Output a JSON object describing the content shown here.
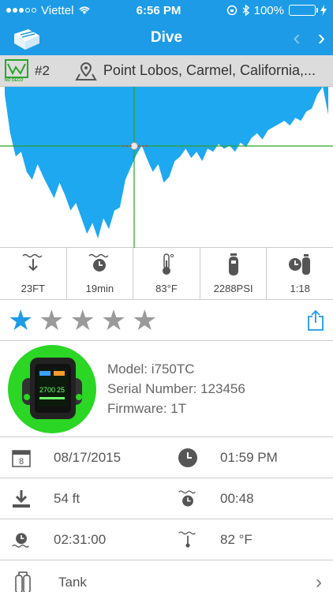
{
  "status": {
    "carrier": "Viettel",
    "time": "6:56 PM",
    "battery": "100%"
  },
  "nav": {
    "title": "Dive",
    "prev_glyph": "‹",
    "next_glyph": "›"
  },
  "info": {
    "dive_number": "#2",
    "location": "Point Lobos, Carmel, California,...",
    "nodeco_label": "NO DECO"
  },
  "chart_data": {
    "type": "area",
    "fill_color": "#1ea8f0",
    "crosshair_color": "#2aa02a",
    "values": [
      0.05,
      0.3,
      0.45,
      0.42,
      0.55,
      0.6,
      0.5,
      0.58,
      0.65,
      0.72,
      0.62,
      0.7,
      0.8,
      0.75,
      0.85,
      0.95,
      0.88,
      0.98,
      0.85,
      0.92,
      0.8,
      0.78,
      0.6,
      0.52,
      0.44,
      0.38,
      0.47,
      0.55,
      0.5,
      0.62,
      0.58,
      0.48,
      0.45,
      0.4,
      0.46,
      0.42,
      0.48,
      0.4,
      0.42,
      0.37,
      0.4,
      0.38,
      0.42,
      0.36,
      0.39,
      0.33,
      0.3,
      0.34,
      0.28,
      0.26,
      0.24,
      0.22,
      0.25,
      0.2,
      0.22,
      0.16,
      0.14,
      0.05,
      0.0,
      0.18
    ]
  },
  "stats": [
    {
      "icon": "max-depth-icon",
      "value": "23FT"
    },
    {
      "icon": "dive-time-icon",
      "value": "19min"
    },
    {
      "icon": "thermometer-icon",
      "value": "83°F"
    },
    {
      "icon": "tank-pressure-icon",
      "value": "2288PSI"
    },
    {
      "icon": "air-time-icon",
      "value": "1:18"
    }
  ],
  "rating": {
    "stars": 1,
    "max": 5,
    "star_glyph": "★"
  },
  "device": {
    "model": "Model: i750TC",
    "serial": "Serial Number: 123456",
    "firmware": "Firmware: 1T",
    "screen_values": {
      "depth": "2700",
      "time": "25"
    }
  },
  "details": {
    "date": "08/17/2015",
    "calendar_day": "8",
    "time": "01:59 PM",
    "max_depth": "54 ft",
    "dive_time": "00:48",
    "surface_interval": "02:31:00",
    "water_temp": "82 °F"
  },
  "tank": {
    "label": "Tank",
    "chevron": "›"
  }
}
